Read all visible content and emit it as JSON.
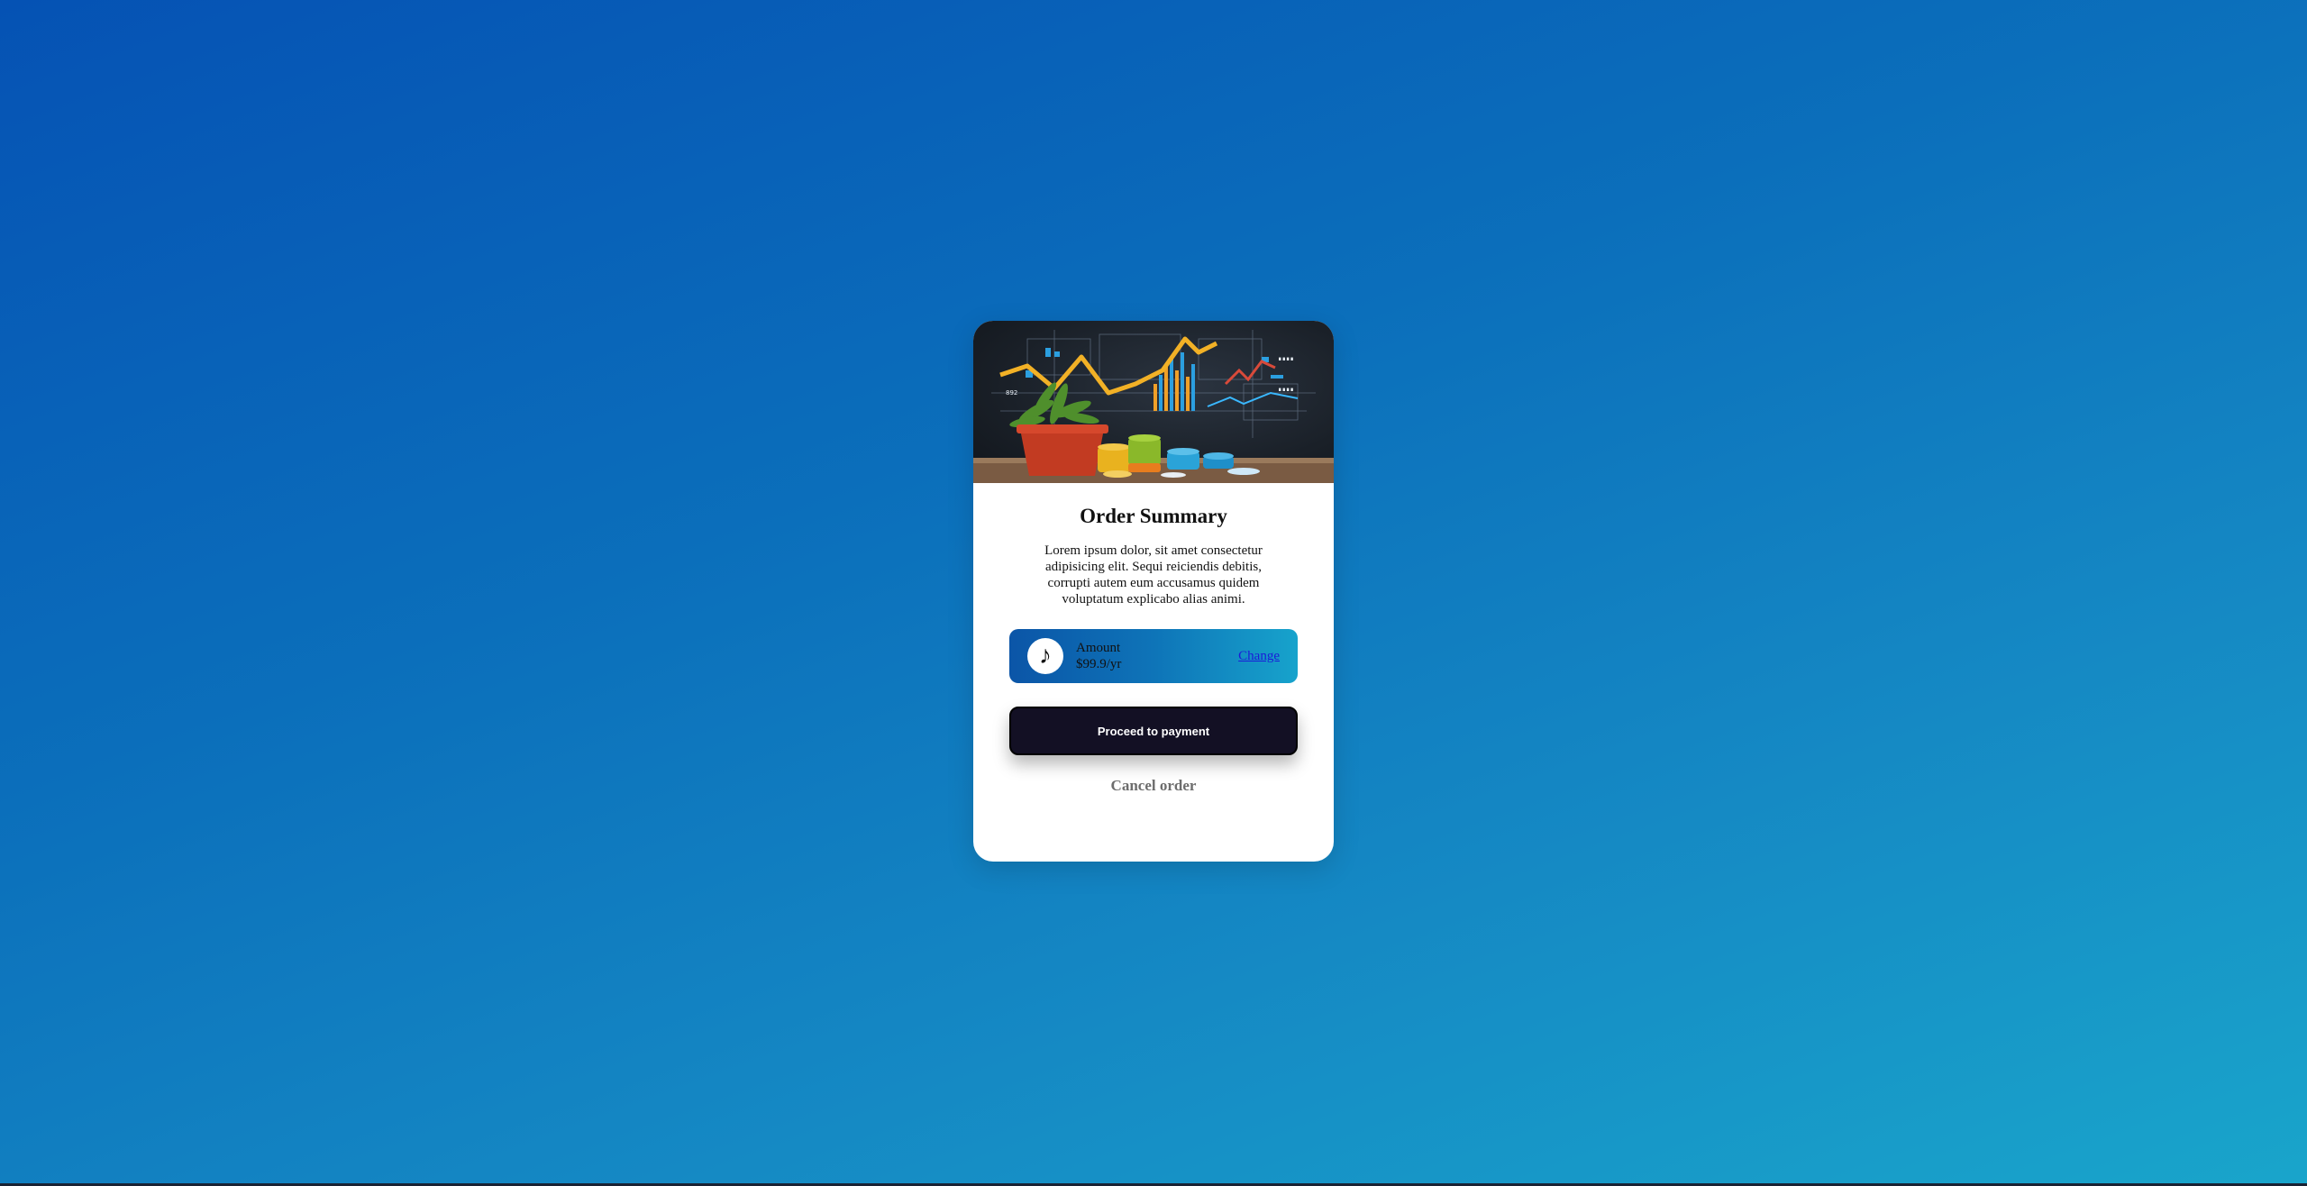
{
  "card": {
    "hero_alt": "plant pot and financial charts illustration",
    "title": "Order Summary",
    "description": "Lorem ipsum dolor, sit amet consectetur adipisicing elit. Sequi reiciendis debitis, corrupti autem eum accusamus quidem voluptatum explicabo alias animi.",
    "plan": {
      "icon": "music-note-icon",
      "label": "Amount",
      "price": "$99.9/yr",
      "change_label": "Change"
    },
    "proceed_label": "Proceed to payment",
    "cancel_label": "Cancel order"
  },
  "colors": {
    "background_start": "#0552b4",
    "background_end": "#19a5cb",
    "button_bg": "#131024",
    "link": "#1b1bd8",
    "cancel_text": "#6d6d6d"
  }
}
